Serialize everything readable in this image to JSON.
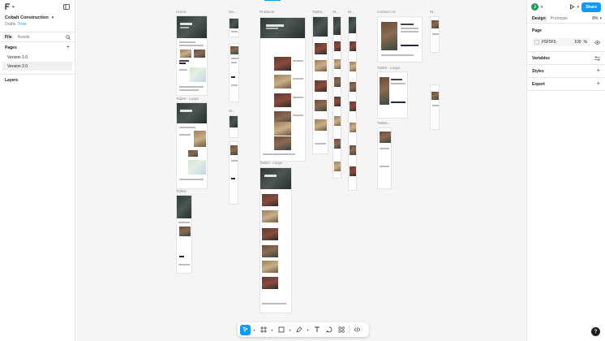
{
  "app": {
    "menu_icon": "figma-menu-icon"
  },
  "project": {
    "name": "Cobalt Construction",
    "location": "Drafts",
    "plan": "Free"
  },
  "left_panel": {
    "tabs": [
      {
        "label": "File"
      },
      {
        "label": "Assets"
      }
    ],
    "pages_title": "Pages",
    "pages": [
      {
        "label": "Version 1.0"
      },
      {
        "label": "Version 2.0"
      }
    ],
    "layers_title": "Layers"
  },
  "right_panel": {
    "avatar_initial": "J",
    "share_label": "Share",
    "tabs": [
      {
        "label": "Design"
      },
      {
        "label": "Prototype"
      }
    ],
    "zoom": "8%",
    "page_section": {
      "title": "Page",
      "fill_hex": "F5F5F5",
      "fill_opacity": "100",
      "fill_unit": "%"
    },
    "sections": [
      {
        "label": "Variables"
      },
      {
        "label": "Styles"
      },
      {
        "label": "Export"
      }
    ],
    "help": "?"
  },
  "canvas": {
    "frame_labels": {
      "home": "Home",
      "mobile1": "Mo...",
      "products": "Products",
      "tablet1": "Tablet...",
      "mobile2": "M...",
      "mobile3": "M...",
      "contact": "Contact Us",
      "mobile4": "M...",
      "tablet_large1": "Tablet - Large",
      "mobile5": "M...",
      "tablet2": "Tablet",
      "tablet_large2": "Tablet - Large",
      "tablet_large3": "Tablet - Large",
      "tablet3": "Tablet..."
    },
    "accent": "#0d99ff"
  },
  "toolbar": {
    "tools": [
      "move-tool",
      "frame-tool",
      "shape-tool",
      "pen-tool",
      "text-tool",
      "comment-tool",
      "actions-tool",
      "dev-mode-tool"
    ]
  }
}
